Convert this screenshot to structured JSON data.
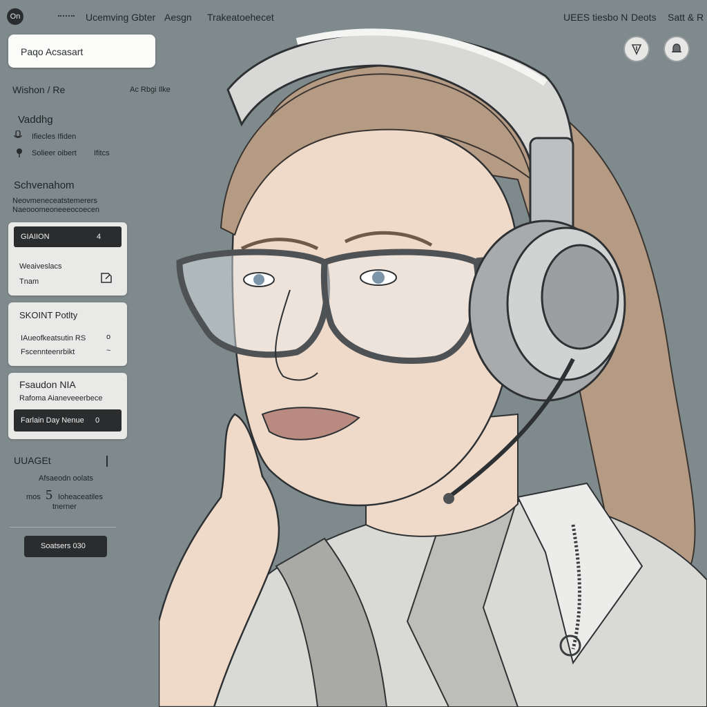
{
  "header": {
    "logo_text": "On",
    "nav": [
      "Ucemving Gbter",
      "Aesgn",
      "Trakeatoehecet"
    ],
    "right_link": "UEES tiesbo N",
    "right_links": [
      "Deots",
      "Satt & R"
    ]
  },
  "search": {
    "text": "Paqo Acsasart"
  },
  "sidebar": {
    "heading_left": "Wishon / Re",
    "heading_right": "Ac Rbgi Ilke",
    "section1_title": "Vaddhg",
    "section1_item1": "Ifiecles Ifiden",
    "section1_item2": "Solieer oibert",
    "section1_item2_right": "Ifitcs",
    "section2_title": "Schvenahom",
    "section2_desc_line1": "Neovmeneceatstemerers",
    "section2_desc_line2": "Naeooomeoneeeocoecen",
    "card1": {
      "bar_label": "GIAIION",
      "bar_right": "4",
      "line1": "Weaiveslacs",
      "line2": "Tnam"
    },
    "card2": {
      "title": "SKOINT Potlty",
      "line1": "IAueofkeatsutin RS",
      "line1_right": "o",
      "line2": "Fscennteenrbikt",
      "line2_right": "~"
    },
    "card3": {
      "title": "Fsaudon NIA",
      "line1": "Rafoma Aianeveeerbece",
      "bar_label": "Farlain Day Nenue",
      "bar_right": "0"
    },
    "usage": {
      "title": "UUAGEt",
      "line1": "Afsaeodn oolats",
      "line2_left": "mos",
      "line2_num": "5",
      "line2_right": "Ioheaceatiles",
      "line3": "tnerner"
    },
    "bottom_button": "Soatsers 030"
  },
  "colors": {
    "background": "#7f8a8c",
    "card": "#e9e9e7",
    "dark": "#2a2c2e",
    "skin": "#efd9c9",
    "hair": "#b59b83"
  },
  "icons": [
    "menu-dots-icon",
    "pen-tip-icon",
    "bell-icon",
    "microphone-icon",
    "pin-icon",
    "edit-icon"
  ]
}
